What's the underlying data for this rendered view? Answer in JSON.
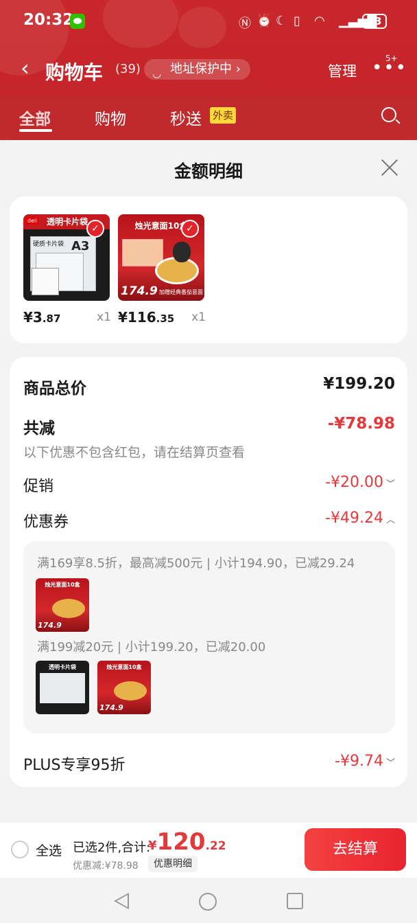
{
  "status_bar": {
    "time": "20:32",
    "battery": "73"
  },
  "header": {
    "title": "购物车",
    "count": "(39)",
    "address": "地址保护中",
    "manage": "管理",
    "more_badge": "5+"
  },
  "tabs": [
    {
      "label": "全部"
    },
    {
      "label": "购物"
    },
    {
      "label": "秒送"
    }
  ],
  "tab_badge": "外卖",
  "sheet": {
    "title": "金额明细"
  },
  "products": [
    {
      "price_int": "¥3",
      "price_dec": ".87",
      "qty": "x1",
      "image_texts": {
        "header": "透明卡片袋",
        "line1": "硬质卡片袋",
        "size": "A3",
        "brand": "deli"
      }
    },
    {
      "price_int": "¥116",
      "price_dec": ".35",
      "qty": "x1",
      "image_texts": {
        "header": "烛光意面10盒",
        "price": "174.9",
        "foot": "加赠经典番茄意面"
      }
    }
  ],
  "summary": {
    "total_label": "商品总价",
    "total_value": "¥199.20",
    "discount_label": "共减",
    "discount_value": "-¥78.98",
    "discount_note": "以下优惠不包含红包，请在结算页查看",
    "promo_label": "促销",
    "promo_value": "-¥20.00",
    "coupon_label": "优惠券",
    "coupon_value": "-¥49.24",
    "coupon_rule_1": "满169享8.5折，最高减500元 | 小计194.90，已减29.24",
    "coupon_rule_2": "满199减20元 | 小计199.20，已减20.00",
    "plus_label": "PLUS专享95折",
    "plus_value": "-¥9.74"
  },
  "bottom_bar": {
    "select_all": "全选",
    "selected": "已选2件,合计:",
    "total_symbol": "¥",
    "total_int": "120",
    "total_dec": ".22",
    "discount_text": "优惠减:¥78.98",
    "detail_button": "优惠明细",
    "checkout_button": "去结算"
  },
  "colors": {
    "brand_red": "#c8272b",
    "price_red": "#e4393c",
    "checkout_red": "#f44141"
  }
}
